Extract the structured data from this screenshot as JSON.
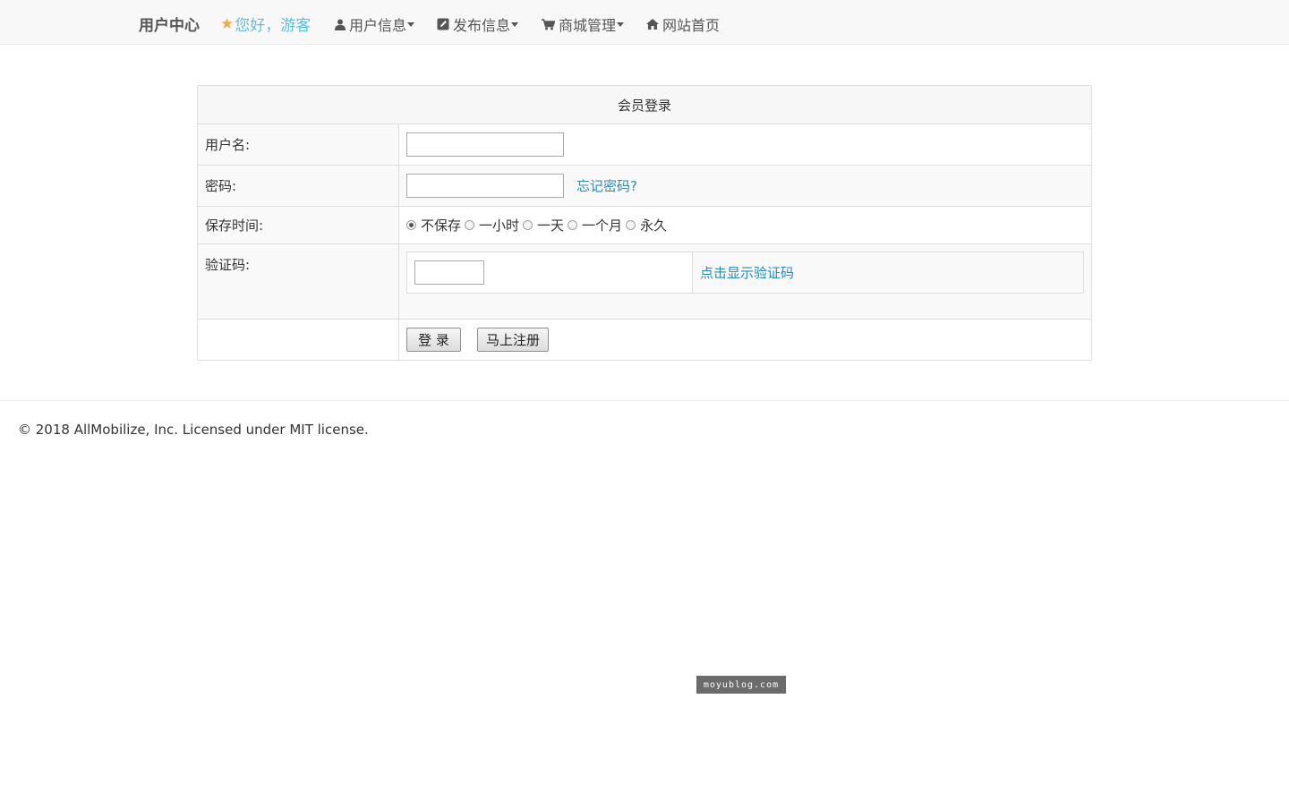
{
  "navbar": {
    "brand": "用户中心",
    "greeting": "您好，游客",
    "greeting_icon": "star-icon",
    "items": [
      {
        "label": "用户信息",
        "icon": "user-icon",
        "dropdown": true
      },
      {
        "label": "发布信息",
        "icon": "edit-icon",
        "dropdown": true
      },
      {
        "label": "商城管理",
        "icon": "cart-icon",
        "dropdown": true
      },
      {
        "label": "网站首页",
        "icon": "home-icon",
        "dropdown": false
      }
    ]
  },
  "login": {
    "title": "会员登录",
    "username_label": "用户名:",
    "username_value": "",
    "password_label": "密码:",
    "password_value": "",
    "forgot_password": "忘记密码?",
    "save_time_label": "保存时间:",
    "save_time_options": [
      "不保存",
      "一小时",
      "一天",
      "一个月",
      "永久"
    ],
    "save_time_selected": "不保存",
    "captcha_label": "验证码:",
    "captcha_value": "",
    "captcha_link": "点击显示验证码",
    "login_button": "登 录",
    "register_button": "马上注册"
  },
  "footer": {
    "text": "© 2018 AllMobilize, Inc. Licensed under MIT license."
  },
  "watermark": "moyublog.com",
  "colors": {
    "link": "#2a8ab7",
    "greeting": "#5bc0de",
    "star": "#f0ad4e",
    "navbar_bg": "#f8f8f8"
  }
}
